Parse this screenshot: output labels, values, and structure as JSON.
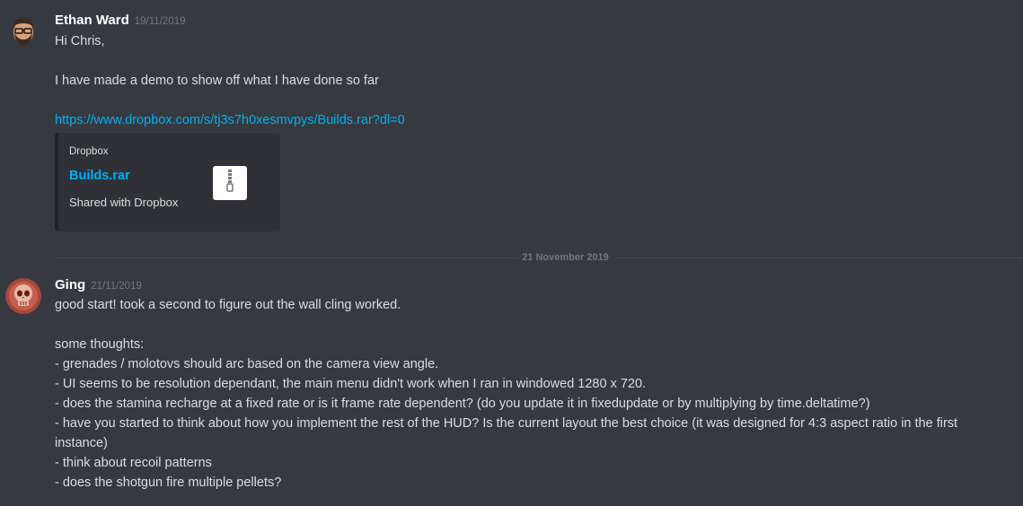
{
  "messages": [
    {
      "author": "Ethan Ward",
      "timestamp": "19/11/2019",
      "lines": [
        "Hi Chris,",
        "",
        "I have made a demo to show off what I have done so far",
        ""
      ],
      "link": "https://www.dropbox.com/s/tj3s7h0xesmvpys/Builds.rar?dl=0",
      "embed": {
        "provider": "Dropbox",
        "title": "Builds.rar",
        "description": "Shared with Dropbox",
        "thumbnail_icon": "zip-file-icon"
      }
    },
    {
      "author": "Ging",
      "timestamp": "21/11/2019",
      "lines": [
        "good start! took a second to figure out the wall cling worked.",
        "",
        "some thoughts:",
        "- grenades / molotovs should arc based on the camera view angle.",
        "- UI seems to be resolution dependant, the main menu didn't work when I ran in windowed 1280 x 720.",
        "- does the stamina recharge at a fixed rate or is it frame rate dependent? (do you update it in fixedupdate or by multiplying by time.deltatime?)",
        "- have you started to think about how you implement the rest of the HUD? Is the current layout the best choice (it was designed for 4:3 aspect ratio in the first instance)",
        "- think about recoil patterns",
        "- does the shotgun fire multiple pellets?"
      ]
    }
  ],
  "date_divider": "21 November 2019",
  "colors": {
    "background": "#36393f",
    "link": "#00b0f4",
    "username": "#ffffff",
    "timestamp": "#72767d",
    "embed_bg": "#2f3136"
  }
}
